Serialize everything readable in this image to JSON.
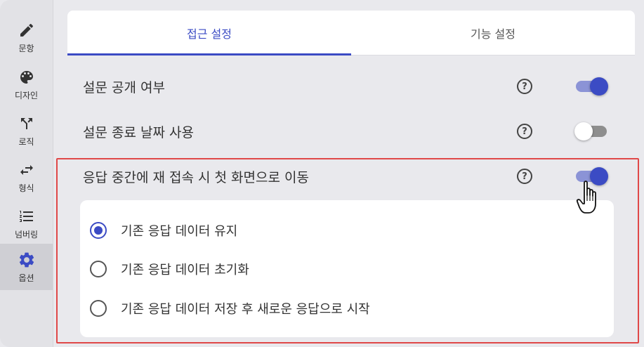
{
  "sidebar": {
    "items": [
      {
        "label": "문항",
        "icon": "pencil-icon"
      },
      {
        "label": "디자인",
        "icon": "palette-icon"
      },
      {
        "label": "로직",
        "icon": "branch-icon"
      },
      {
        "label": "형식",
        "icon": "swap-arrows-icon"
      },
      {
        "label": "넘버링",
        "icon": "numbered-list-icon"
      },
      {
        "label": "옵션",
        "icon": "gear-icon",
        "active": true
      }
    ]
  },
  "tabs": [
    {
      "label": "접근 설정",
      "active": true
    },
    {
      "label": "기능 설정",
      "active": false
    }
  ],
  "settings": [
    {
      "label": "설문 공개 여부",
      "help": "?",
      "toggle": "on"
    },
    {
      "label": "설문 종료 날짜 사용",
      "help": "?",
      "toggle": "off"
    },
    {
      "label": "응답 중간에 재 접속 시 첫 화면으로 이동",
      "help": "?",
      "toggle": "on"
    }
  ],
  "resume_options": [
    {
      "label": "기존 응답 데이터 유지",
      "checked": true
    },
    {
      "label": "기존 응답 데이터 초기화",
      "checked": false
    },
    {
      "label": "기존 응답 데이터 저장 후 새로운 응답으로 시작",
      "checked": false
    }
  ],
  "colors": {
    "accent": "#3b4bc4",
    "highlight_border": "#e04848"
  }
}
